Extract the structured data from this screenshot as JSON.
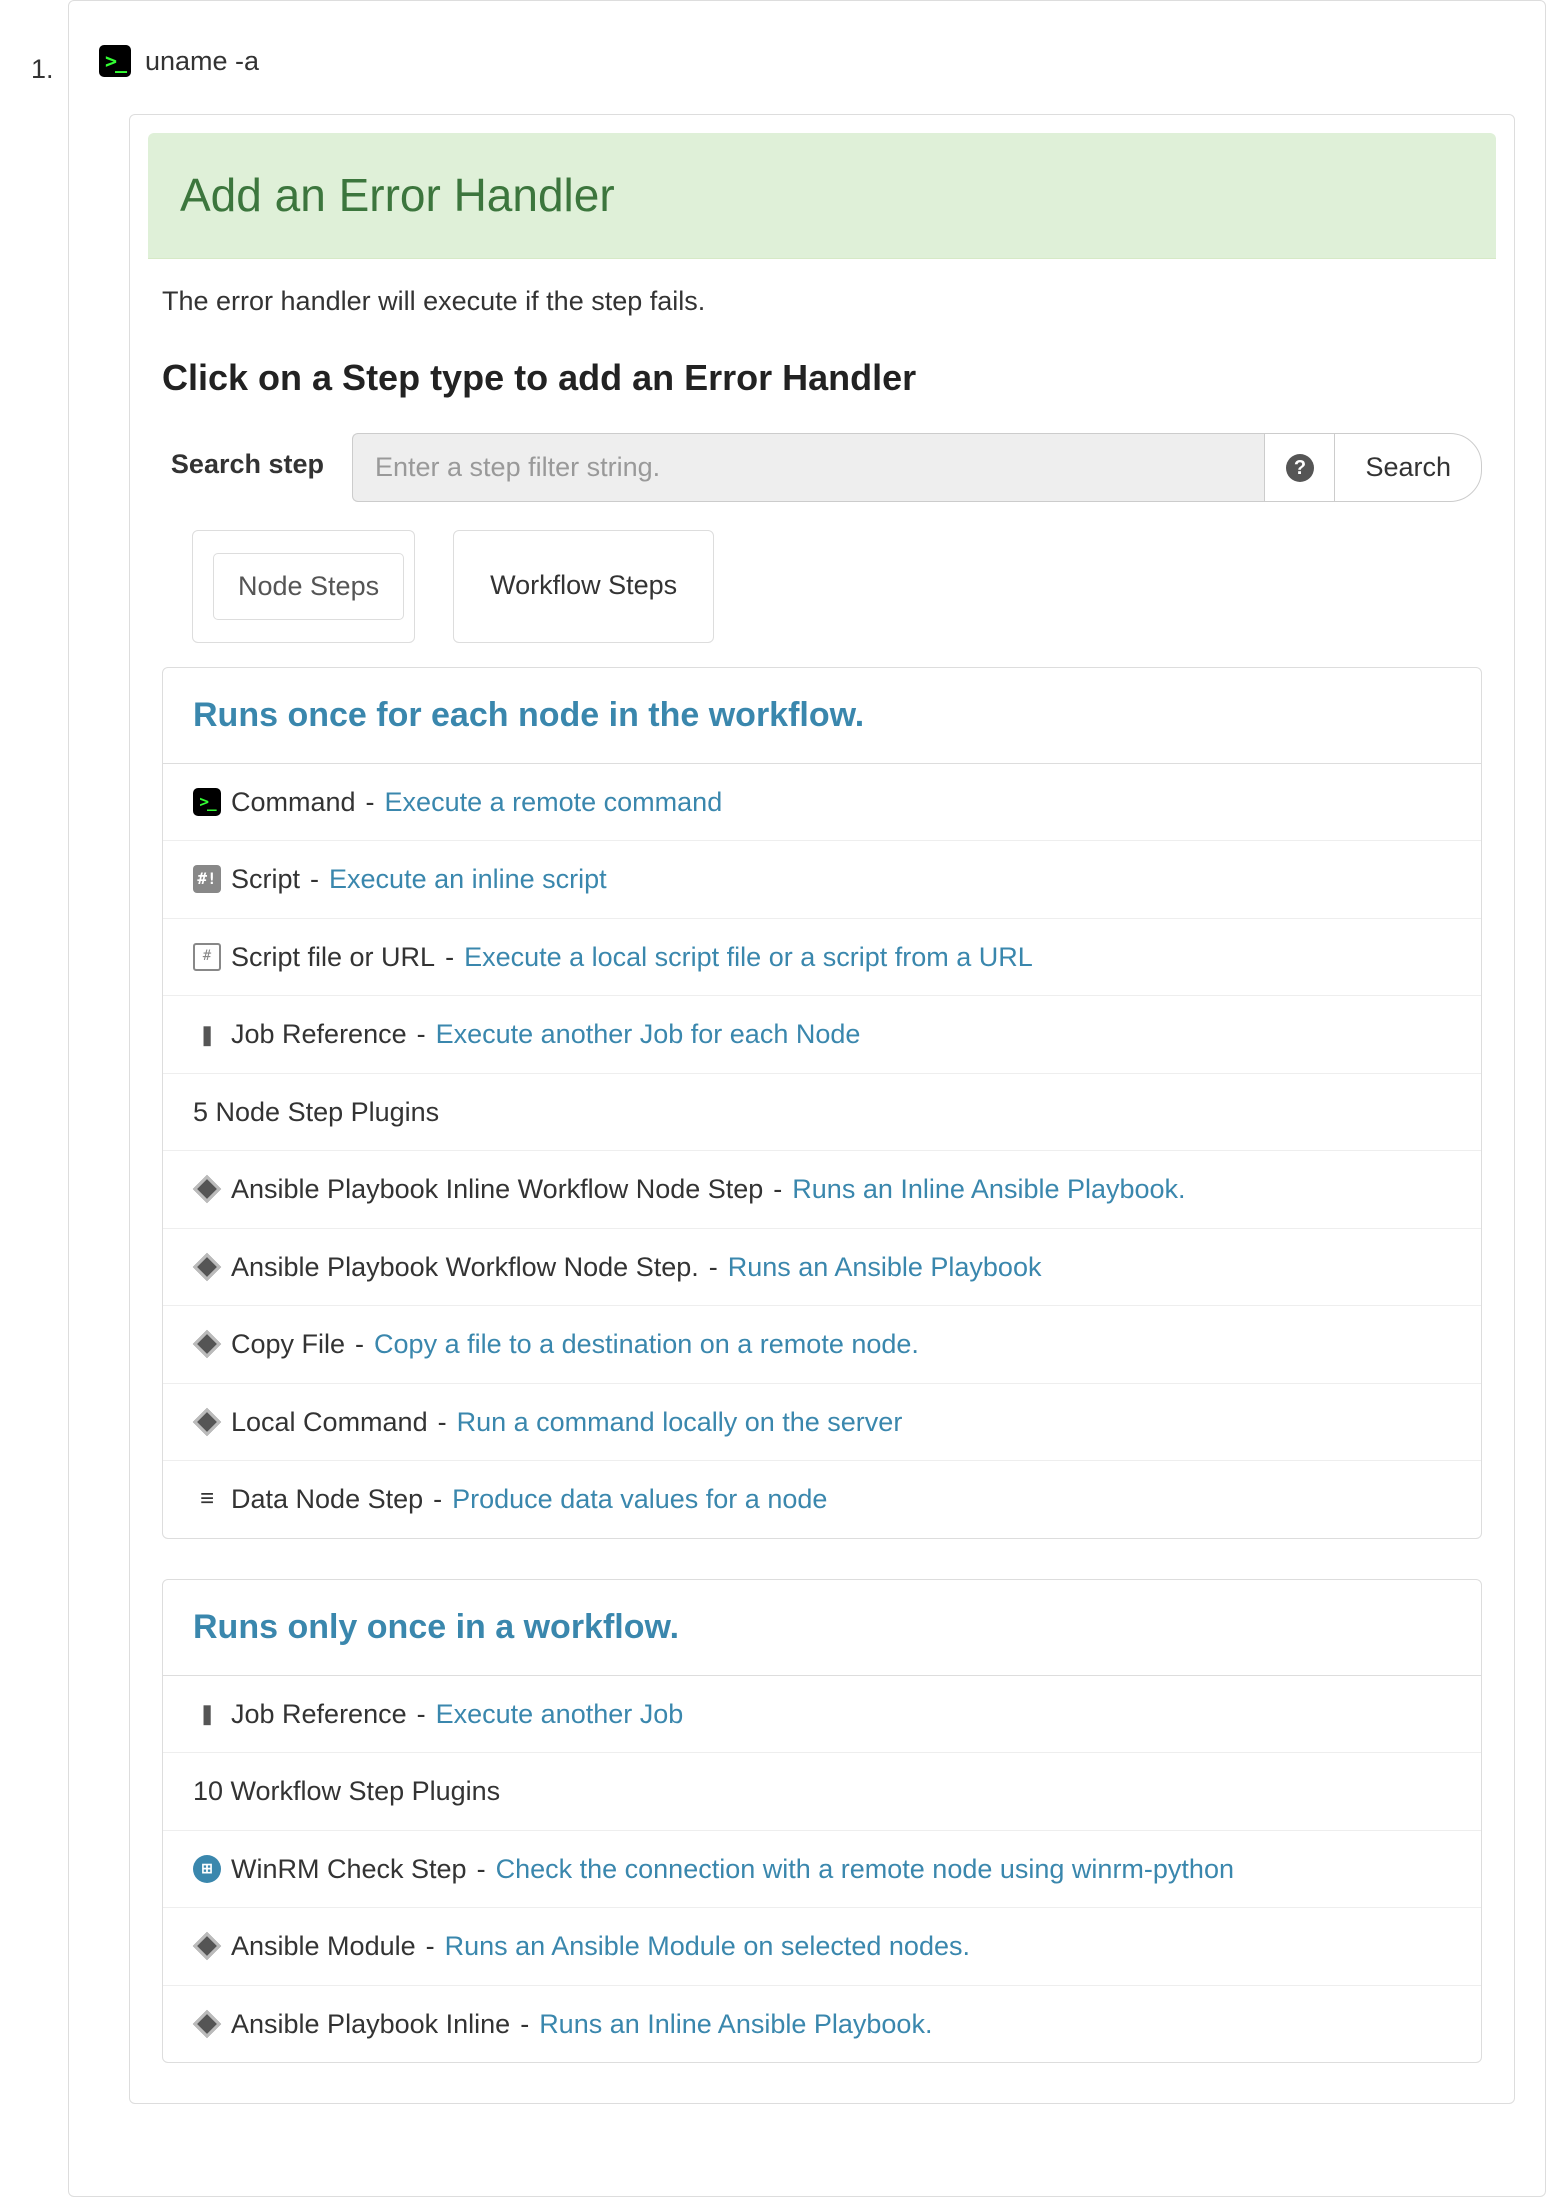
{
  "step_number": "1.",
  "step_command": "uname -a",
  "panel": {
    "title": "Add an Error Handler",
    "description": "The error handler will execute if the step fails.",
    "subtitle": "Click on a Step type to add an Error Handler"
  },
  "search": {
    "label": "Search step",
    "placeholder": "Enter a step filter string.",
    "button": "Search"
  },
  "tabs": {
    "node": "Node Steps",
    "workflow": "Workflow Steps"
  },
  "node_section": {
    "title": "Runs once for each node in the workflow.",
    "items": [
      {
        "icon": "term",
        "name": "Command",
        "desc": "Execute a remote command"
      },
      {
        "icon": "script",
        "name": "Script",
        "desc": "Execute an inline script"
      },
      {
        "icon": "file",
        "name": "Script file or URL",
        "desc": "Execute a local script file or a script from a URL"
      },
      {
        "icon": "book",
        "name": "Job Reference",
        "desc": "Execute another Job for each Node"
      }
    ],
    "plugins_header": "5 Node Step Plugins",
    "plugins": [
      {
        "icon": "diamond",
        "name": "Ansible Playbook Inline Workflow Node Step",
        "desc": "Runs an Inline Ansible Playbook."
      },
      {
        "icon": "diamond",
        "name": "Ansible Playbook Workflow Node Step.",
        "desc": "Runs an Ansible Playbook"
      },
      {
        "icon": "diamond",
        "name": "Copy File",
        "desc": "Copy a file to a destination on a remote node."
      },
      {
        "icon": "diamond",
        "name": "Local Command",
        "desc": "Run a command locally on the server"
      },
      {
        "icon": "db",
        "name": "Data Node Step",
        "desc": "Produce data values for a node"
      }
    ]
  },
  "workflow_section": {
    "title": "Runs only once in a workflow.",
    "items": [
      {
        "icon": "book",
        "name": "Job Reference",
        "desc": "Execute another Job"
      }
    ],
    "plugins_header": "10 Workflow Step Plugins",
    "plugins": [
      {
        "icon": "win",
        "name": "WinRM Check Step",
        "desc": "Check the connection with a remote node using winrm-python"
      },
      {
        "icon": "diamond",
        "name": "Ansible Module",
        "desc": "Runs an Ansible Module on selected nodes."
      },
      {
        "icon": "diamond",
        "name": "Ansible Playbook Inline",
        "desc": "Runs an Inline Ansible Playbook."
      }
    ]
  }
}
